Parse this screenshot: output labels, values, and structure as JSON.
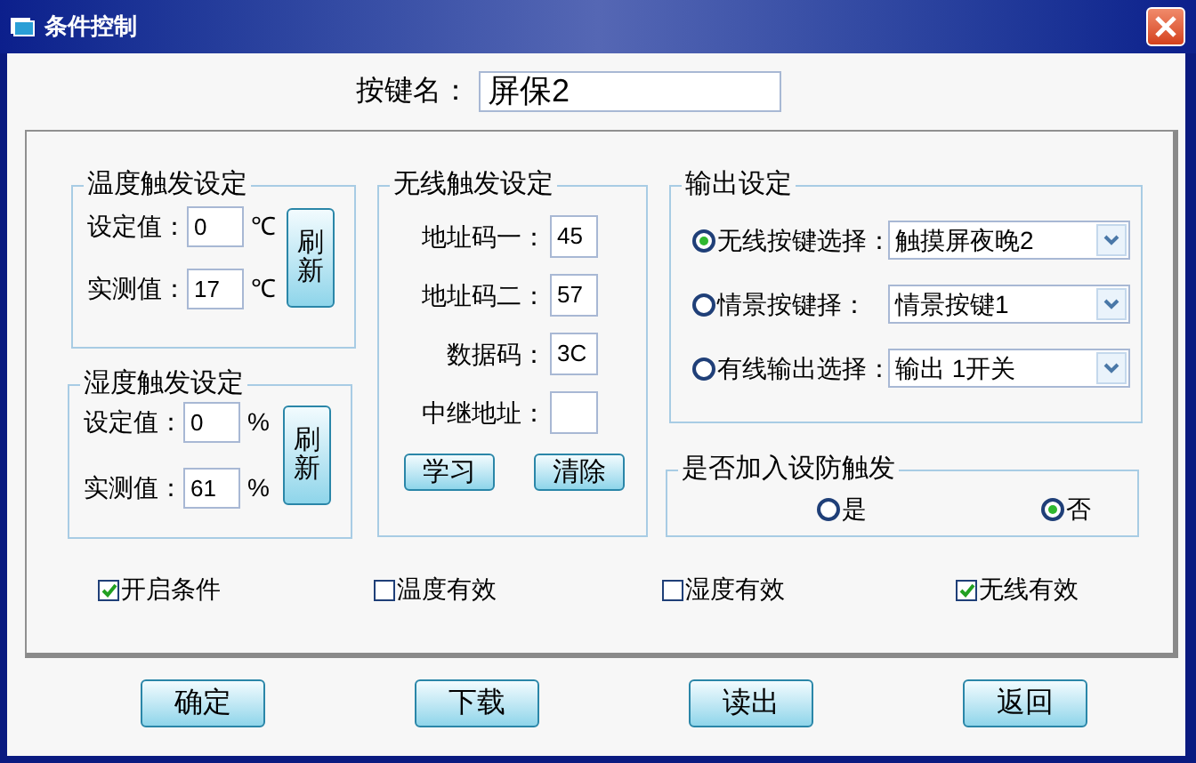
{
  "window": {
    "title": "条件控制"
  },
  "key_name": {
    "label": "按键名：",
    "value": "屏保2"
  },
  "temperature": {
    "title": "温度触发设定",
    "rows": [
      {
        "label": "设定值：",
        "value": "0",
        "unit": "℃"
      },
      {
        "label": "实测值：",
        "value": "17",
        "unit": "℃"
      }
    ],
    "refresh_button": "刷新"
  },
  "humidity": {
    "title": "湿度触发设定",
    "rows": [
      {
        "label": "设定值：",
        "value": "0",
        "unit": "%"
      },
      {
        "label": "实测值：",
        "value": "61",
        "unit": "%"
      }
    ],
    "refresh_button": "刷新"
  },
  "wireless": {
    "title": "无线触发设定",
    "fields": [
      {
        "label": "地址码一：",
        "value": "45"
      },
      {
        "label": "地址码二：",
        "value": "57"
      },
      {
        "label": "数据码：",
        "value": "3C"
      },
      {
        "label": "中继地址："
      }
    ],
    "buttons": [
      "学习",
      "清除"
    ]
  },
  "output": {
    "title": "输出设定",
    "options": [
      {
        "label": "无线按键选择：",
        "selected": true,
        "value": "触摸屏夜晚2"
      },
      {
        "label": "情景按键择：",
        "selected": false,
        "value": "情景按键1"
      },
      {
        "label": "有线输出选择：",
        "selected": false,
        "value": "输出 1开关"
      }
    ]
  },
  "arming": {
    "title": "是否加入设防触发",
    "options": [
      {
        "label": "是",
        "selected": false
      },
      {
        "label": "否",
        "selected": true
      }
    ]
  },
  "checkboxes": [
    {
      "label": "开启条件",
      "checked": true
    },
    {
      "label": "温度有效",
      "checked": false
    },
    {
      "label": "湿度有效",
      "checked": false
    },
    {
      "label": "无线有效",
      "checked": true
    }
  ],
  "buttons": [
    "确定",
    "下载",
    "读出",
    "返回"
  ]
}
